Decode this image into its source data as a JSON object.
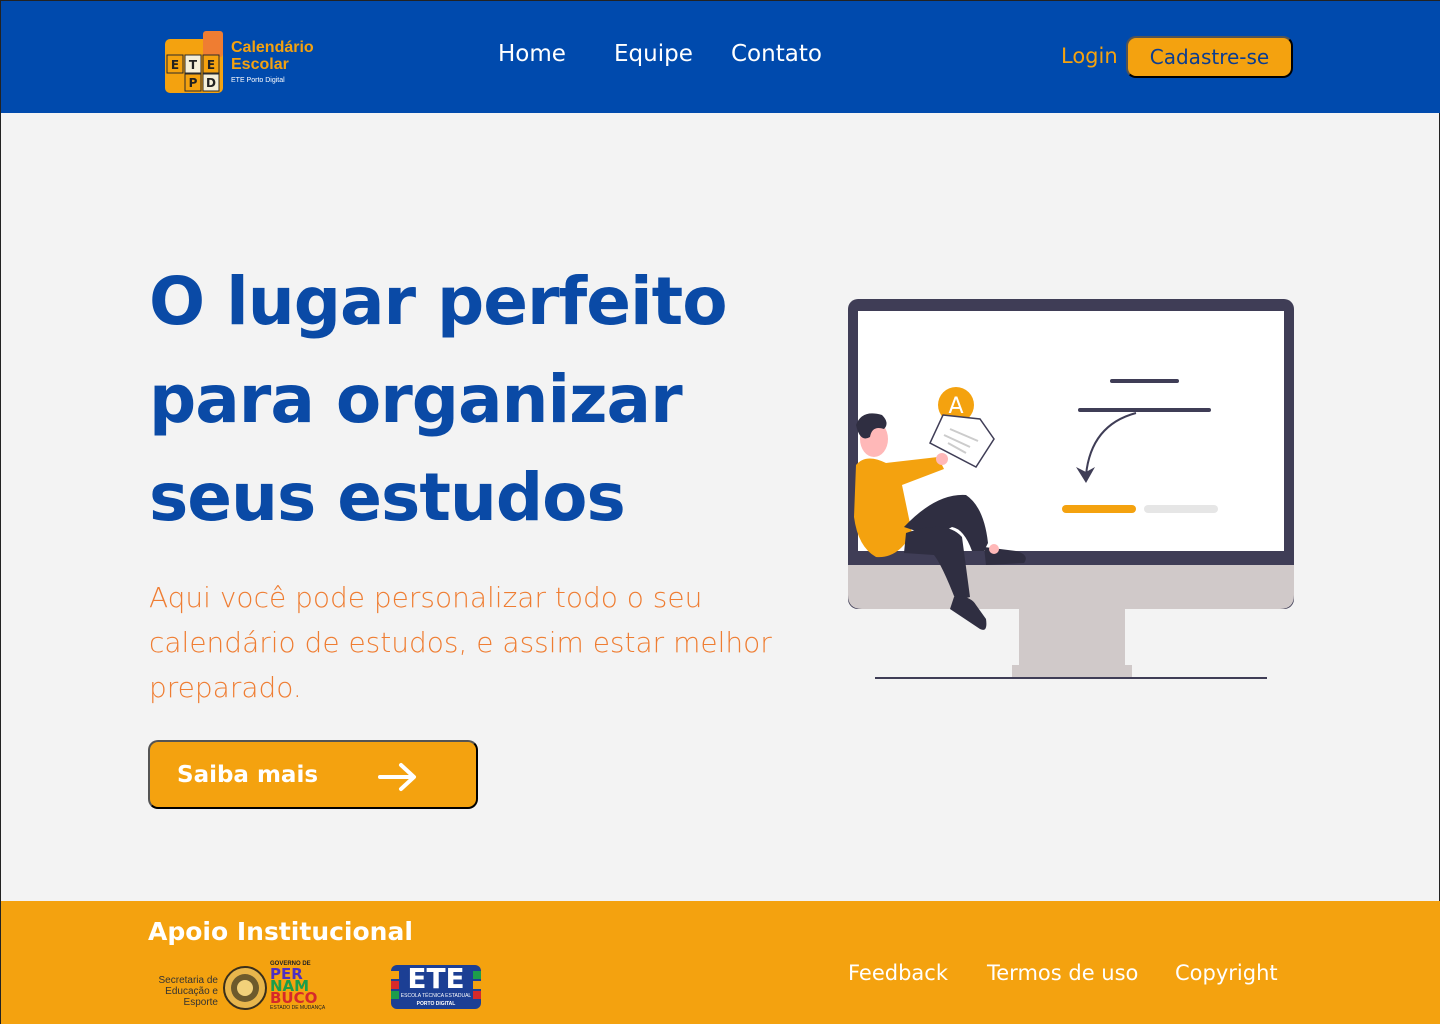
{
  "header": {
    "logo": {
      "grid_letters": [
        "E",
        "T",
        "E",
        "P",
        "D"
      ],
      "title_line1": "Calendário",
      "title_line2": "Escolar",
      "subtitle": "ETE Porto Digital"
    },
    "nav": [
      {
        "label": "Home"
      },
      {
        "label": "Equipe"
      },
      {
        "label": "Contato"
      }
    ],
    "login_label": "Login",
    "signup_label": "Cadastre-se"
  },
  "hero": {
    "title_lines": [
      "O lugar perfeito",
      "para organizar",
      "seus estudos"
    ],
    "description": "Aqui você pode personalizar todo o seu calendário de estudos, e assim estar melhor preparado.",
    "cta_label": "Saiba mais",
    "illustration_badge": "A"
  },
  "footer": {
    "title": "Apoio Institucional",
    "secretaria_text": "Secretaria de Educação e Esporte",
    "pe_logo": {
      "top": "GOVERNO DE",
      "lines": [
        "PER",
        "NAM",
        "BUCO"
      ],
      "bottom": "ESTADO DE MUDANÇA"
    },
    "ete_logo": {
      "word": "ETE",
      "line1": "ESCOLA TÉCNICA ESTADUAL",
      "line2": "PORTO DIGITAL"
    },
    "links": [
      {
        "label": "Feedback"
      },
      {
        "label": "Termos de uso"
      },
      {
        "label": "Copyright"
      }
    ]
  },
  "colors": {
    "primary_blue": "#004aad",
    "accent_yellow": "#f4a20f",
    "accent_orange": "#ef7d32",
    "background": "#f3f3f3"
  },
  "icons": {
    "cta": "arrow-right-icon"
  }
}
